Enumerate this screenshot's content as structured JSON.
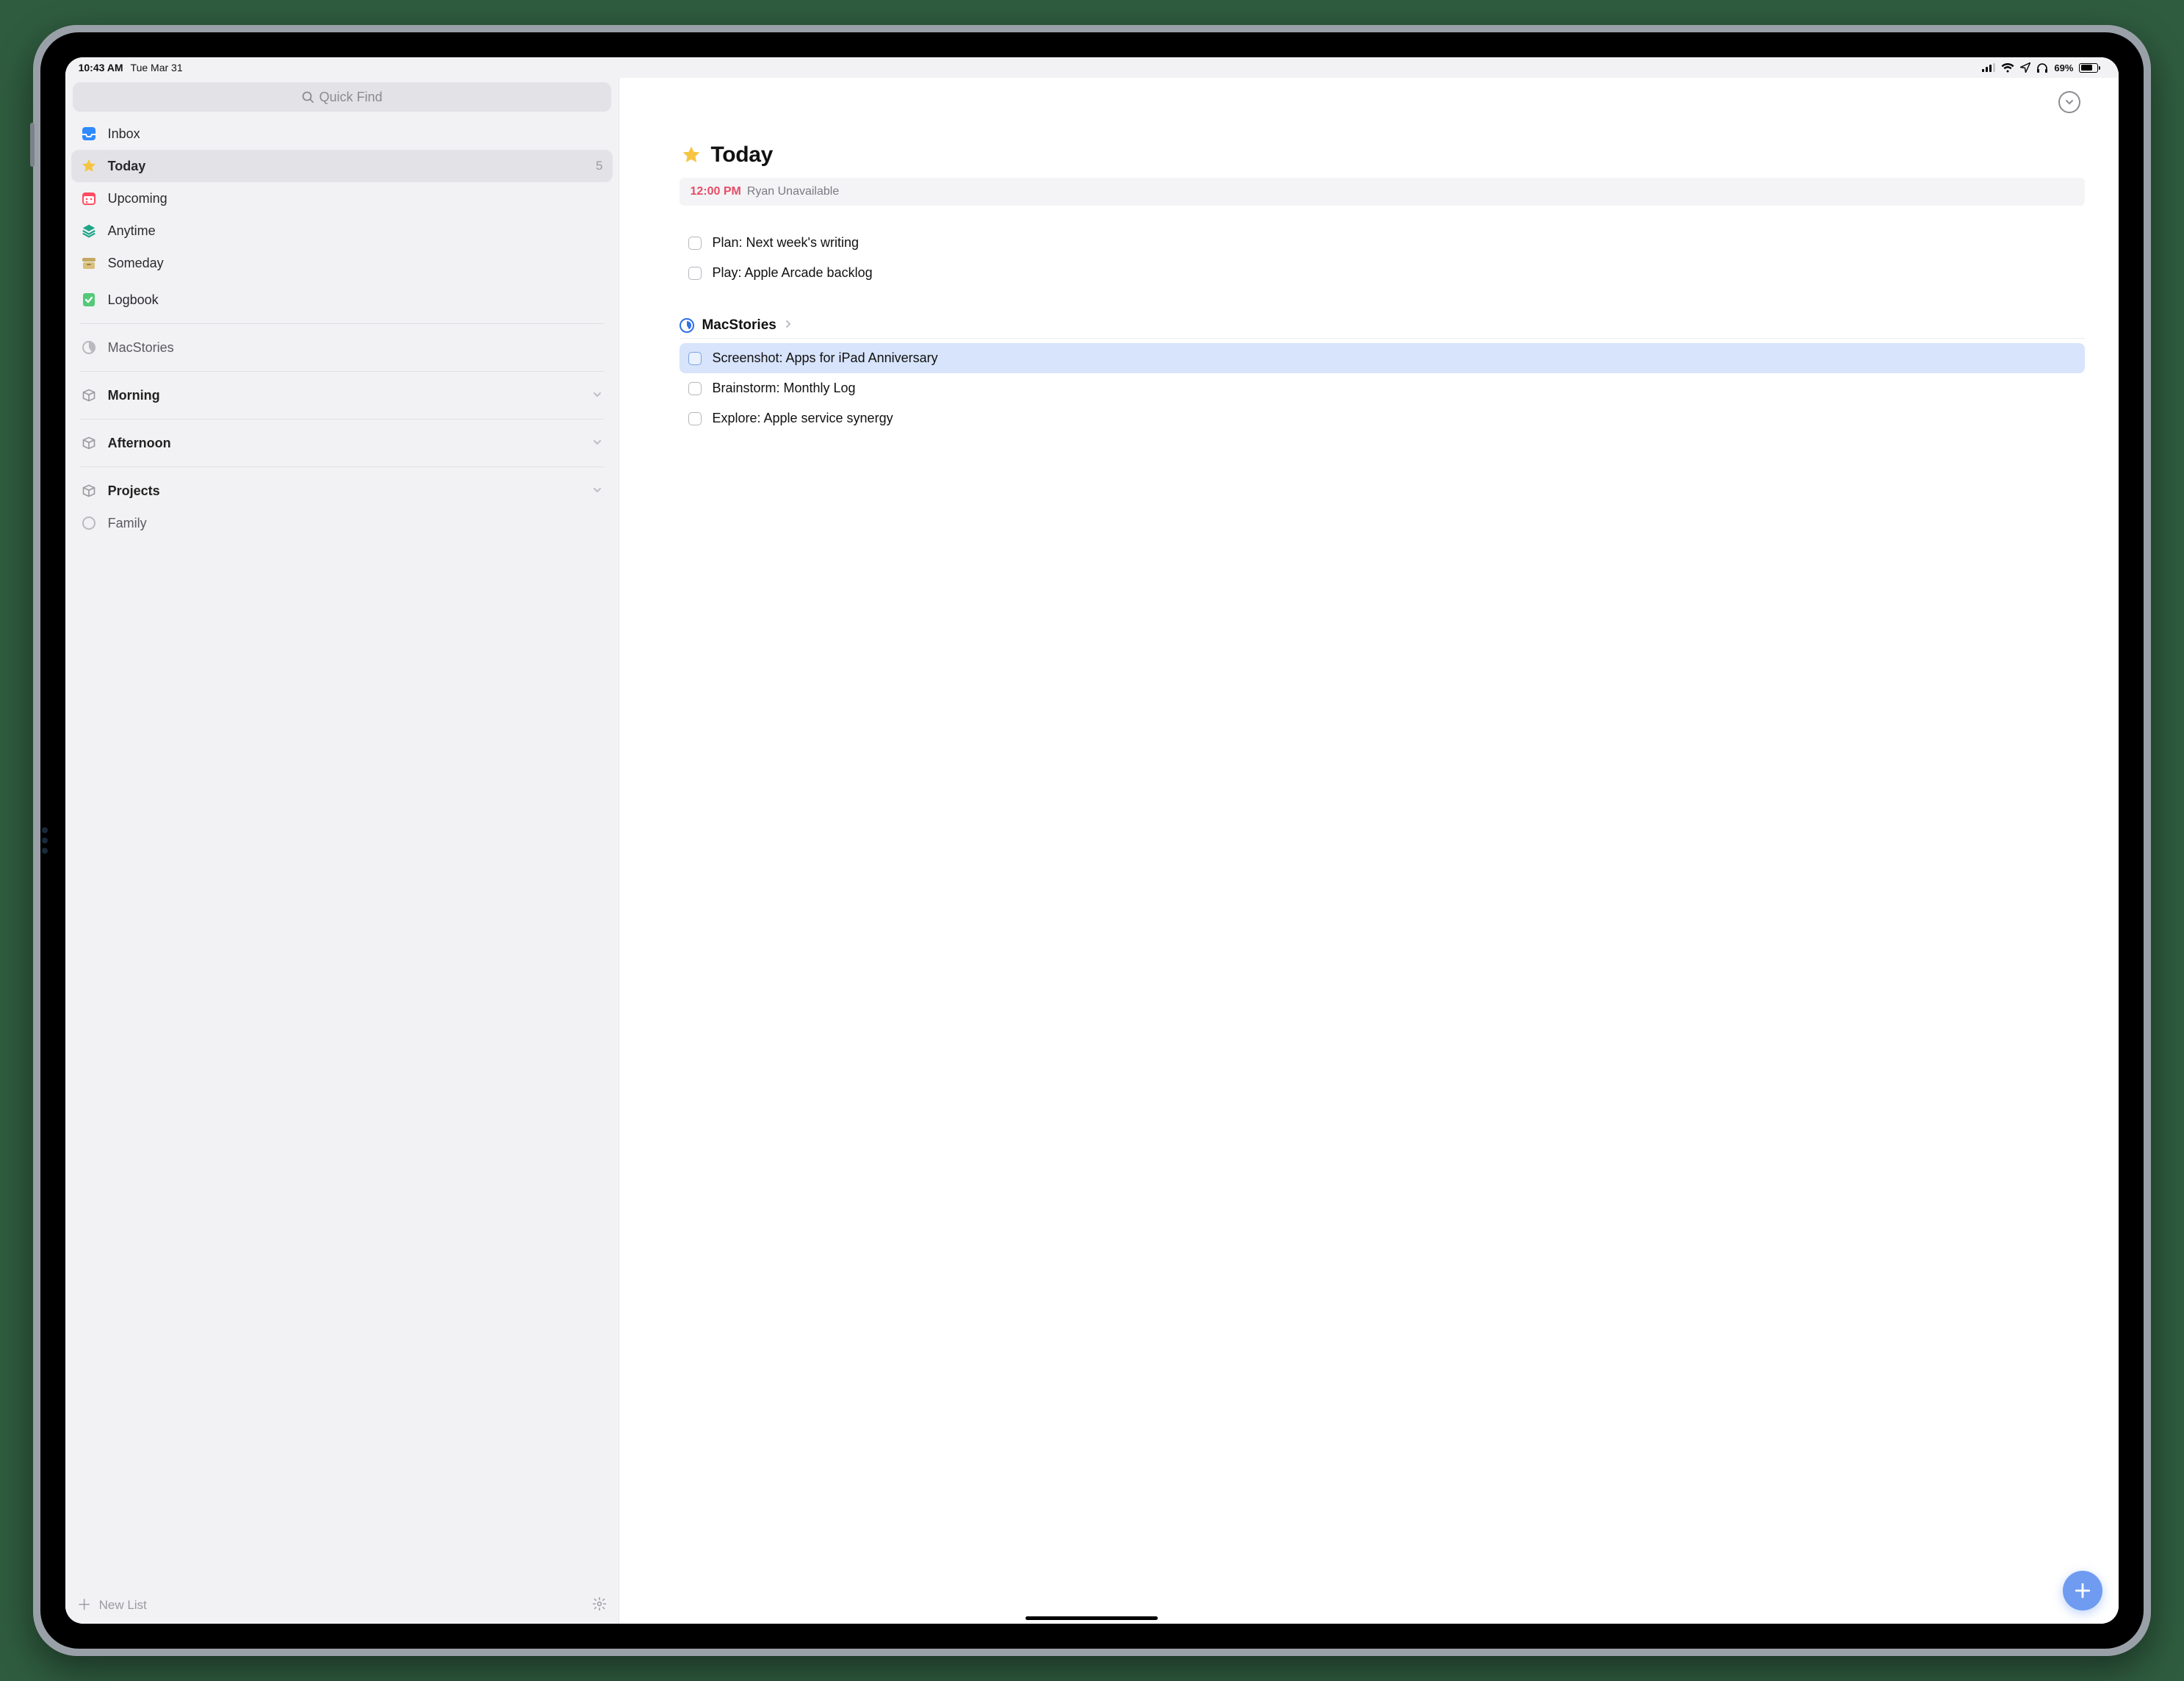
{
  "status": {
    "time": "10:43 AM",
    "date": "Tue Mar 31",
    "battery_pct": "69%"
  },
  "sidebar": {
    "search_placeholder": "Quick Find",
    "items": [
      {
        "label": "Inbox"
      },
      {
        "label": "Today",
        "count": "5"
      },
      {
        "label": "Upcoming"
      },
      {
        "label": "Anytime"
      },
      {
        "label": "Someday"
      },
      {
        "label": "Logbook"
      }
    ],
    "projects": [
      {
        "label": "MacStories"
      }
    ],
    "areas": [
      {
        "label": "Morning"
      },
      {
        "label": "Afternoon"
      },
      {
        "label": "Projects",
        "children": [
          {
            "label": "Family"
          }
        ]
      }
    ],
    "new_list_label": "New List"
  },
  "page": {
    "title": "Today",
    "event": {
      "time": "12:00 PM",
      "name": "Ryan Unavailable"
    },
    "tasks": [
      {
        "label": "Plan: Next week's writing"
      },
      {
        "label": "Play: Apple Arcade backlog"
      }
    ],
    "section": {
      "name": "MacStories"
    },
    "section_tasks": [
      {
        "label": "Screenshot: Apps for iPad Anniversary"
      },
      {
        "label": "Brainstorm: Monthly Log"
      },
      {
        "label": "Explore: Apple service synergy"
      }
    ]
  }
}
